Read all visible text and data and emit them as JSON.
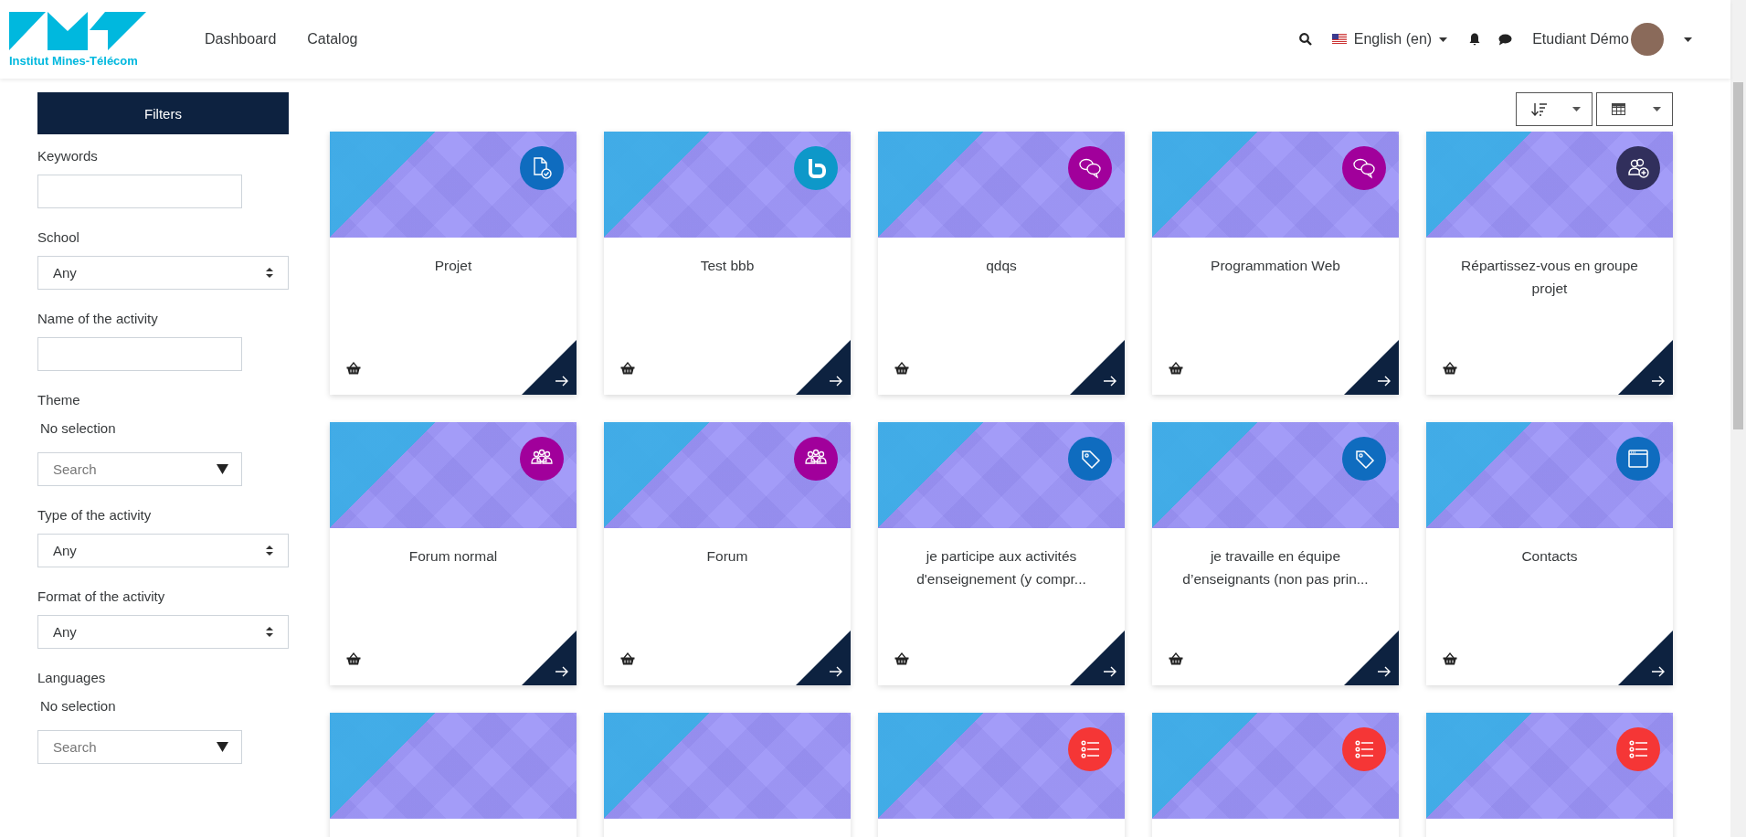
{
  "header": {
    "logo_text": "Institut Mines-Télécom",
    "nav": [
      {
        "label": "Dashboard"
      },
      {
        "label": "Catalog"
      }
    ],
    "language": "English (en)",
    "user_name": "Etudiant Démo"
  },
  "filters": {
    "title": "Filters",
    "fields": [
      {
        "label": "Keywords",
        "kind": "text"
      },
      {
        "label": "School",
        "kind": "select",
        "value": "Any"
      },
      {
        "label": "Name of the activity",
        "kind": "text"
      },
      {
        "label": "Theme",
        "kind": "multi",
        "selection": "No selection",
        "placeholder": "Search"
      },
      {
        "label": "Type of the activity",
        "kind": "select",
        "value": "Any"
      },
      {
        "label": "Format of the activity",
        "kind": "select",
        "value": "Any"
      },
      {
        "label": "Languages",
        "kind": "multi",
        "selection": "No selection",
        "placeholder": "Search"
      }
    ]
  },
  "cards": [
    {
      "kind": "course",
      "title": "Projet",
      "icon": {
        "kind": "assignment",
        "color": "#0f6cbf"
      }
    },
    {
      "kind": "course",
      "title": "Test bbb",
      "icon": {
        "kind": "bbb",
        "color": "#0e98c9"
      }
    },
    {
      "kind": "course",
      "title": "qdqs",
      "icon": {
        "kind": "chat",
        "color": "#a1009b"
      }
    },
    {
      "kind": "course",
      "title": "Programmation Web",
      "icon": {
        "kind": "chat",
        "color": "#a1009b"
      }
    },
    {
      "kind": "course",
      "title": "Répartissez-vous en groupe projet",
      "icon": {
        "kind": "group",
        "color": "#312f5c"
      }
    },
    {
      "kind": "course",
      "title": "Forum normal",
      "icon": {
        "kind": "forum",
        "color": "#a1009b"
      }
    },
    {
      "kind": "course",
      "title": "Forum",
      "icon": {
        "kind": "forum",
        "color": "#a1009b"
      }
    },
    {
      "kind": "course",
      "title": "je participe aux activités d'enseignement (y compr...",
      "icon": {
        "kind": "tag",
        "color": "#0f6cbf"
      }
    },
    {
      "kind": "course",
      "title": "je travaille en équipe d’enseignants (non pas prin...",
      "icon": {
        "kind": "tag",
        "color": "#0f6cbf"
      }
    },
    {
      "kind": "course",
      "title": "Contacts",
      "icon": {
        "kind": "page",
        "color": "#0f6cbf"
      }
    },
    {
      "kind": "course"
    },
    {
      "kind": "course"
    },
    {
      "kind": "course",
      "icon": {
        "kind": "list",
        "color": "#f53636"
      }
    },
    {
      "kind": "course",
      "icon": {
        "kind": "list",
        "color": "#f53636"
      }
    },
    {
      "kind": "course",
      "icon": {
        "kind": "list",
        "color": "#f53636"
      }
    }
  ]
}
